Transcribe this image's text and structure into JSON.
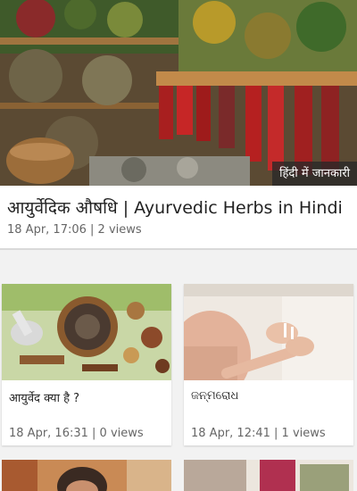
{
  "hero": {
    "tag": "हिंदी में जानकारी"
  },
  "feature": {
    "title": "आयुर्वेदिक औषधि | Ayurvedic Herbs in Hindi",
    "meta": "18 Apr, 17:06 | 2 views"
  },
  "cards": [
    {
      "title": "आयुर्वेद क्या है ?",
      "meta": "18 Apr, 16:31 | 0 views"
    },
    {
      "title": "ଜନ୍ମରୋଧ",
      "meta": "18 Apr, 12:41 | 1 views"
    }
  ]
}
